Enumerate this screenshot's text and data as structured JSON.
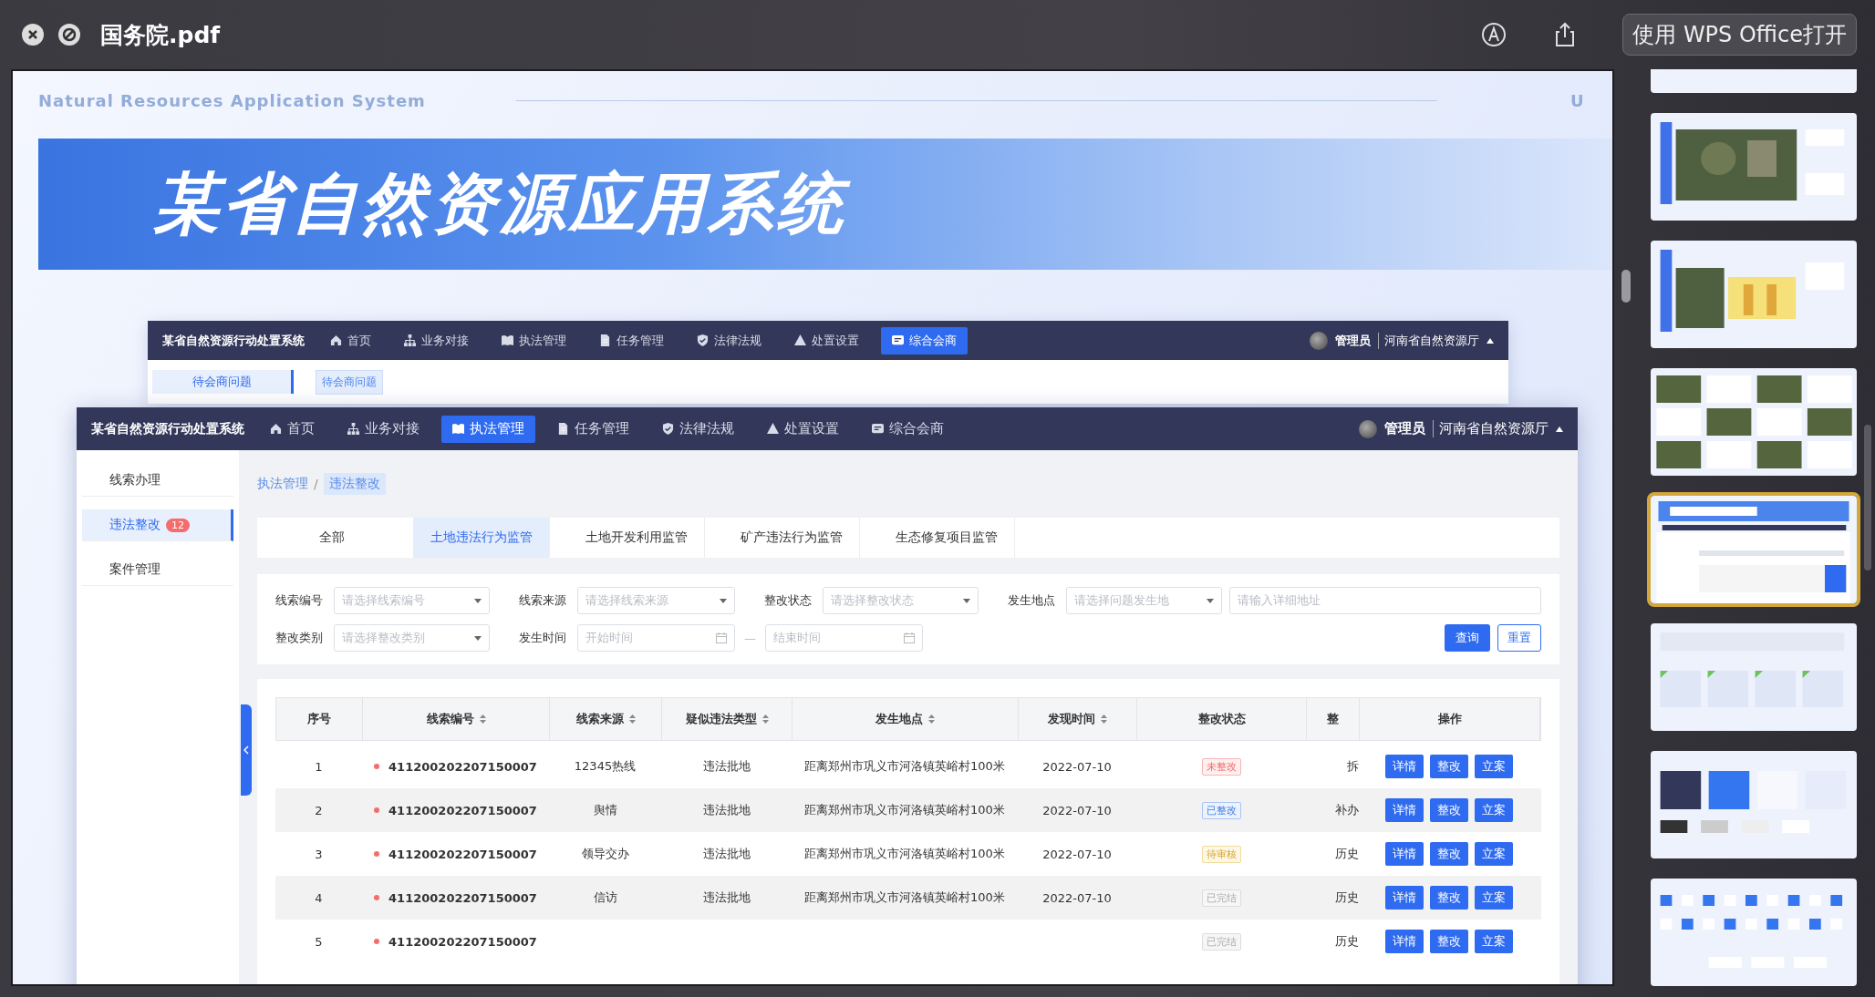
{
  "window": {
    "title": "国务院.pdf",
    "open_button": "使用 WPS Office打开"
  },
  "slide": {
    "subtitle": "Natural Resources Application System",
    "corner_text": "U",
    "title": "某省自然资源应用系统",
    "back_screen": {
      "system_title": "某省自然资源行动处置系统",
      "nav": [
        {
          "label": "首页",
          "selected": false
        },
        {
          "label": "业务对接",
          "selected": false
        },
        {
          "label": "执法管理",
          "selected": false
        },
        {
          "label": "任务管理",
          "selected": false
        },
        {
          "label": "法律法规",
          "selected": false
        },
        {
          "label": "处置设置",
          "selected": false
        },
        {
          "label": "综合会商",
          "selected": true
        }
      ],
      "user": "管理员",
      "org": "河南省自然资源厅",
      "sidebar_item": "待会商问题",
      "tag": "待会商问题"
    },
    "front_screen": {
      "system_title": "某省自然资源行动处置系统",
      "nav": [
        {
          "label": "首页",
          "selected": false
        },
        {
          "label": "业务对接",
          "selected": false
        },
        {
          "label": "执法管理",
          "selected": true
        },
        {
          "label": "任务管理",
          "selected": false
        },
        {
          "label": "法律法规",
          "selected": false
        },
        {
          "label": "处置设置",
          "selected": false
        },
        {
          "label": "综合会商",
          "selected": false
        }
      ],
      "user": "管理员",
      "org": "河南省自然资源厅",
      "sidebar": [
        {
          "label": "线索办理",
          "selected": false
        },
        {
          "label": "违法整改",
          "selected": true,
          "badge": "12"
        },
        {
          "label": "案件管理",
          "selected": false
        }
      ],
      "breadcrumb": [
        "执法管理",
        "违法整改"
      ],
      "breadcrumb_separator": "/",
      "tabs": [
        {
          "label": "全部",
          "selected": false
        },
        {
          "label": "土地违法行为监管",
          "selected": true
        },
        {
          "label": "土地开发利用监管",
          "selected": false
        },
        {
          "label": "矿产违法行为监管",
          "selected": false
        },
        {
          "label": "生态修复项目监管",
          "selected": false
        }
      ],
      "filters": [
        {
          "kind": "select",
          "label": "线索编号",
          "placeholder": "请选择线索编号"
        },
        {
          "kind": "select",
          "label": "线索来源",
          "placeholder": "请选择线索来源"
        },
        {
          "kind": "select",
          "label": "整改状态",
          "placeholder": "请选择整改状态"
        },
        {
          "kind": "location",
          "label": "发生地点",
          "placeholder": "请选择问题发生地",
          "detail_placeholder": "请输入详细地址"
        },
        {
          "kind": "select",
          "label": "整改类别",
          "placeholder": "请选择整改类别"
        },
        {
          "kind": "daterange",
          "label": "发生时间",
          "placeholder": "开始时间",
          "end_placeholder": "结束时间",
          "separator": "—"
        }
      ],
      "search_button": "查询",
      "reset_button": "重置",
      "table": {
        "columns": [
          {
            "label": "序号",
            "sortable": false
          },
          {
            "label": "线索编号",
            "sortable": true
          },
          {
            "label": "线索来源",
            "sortable": true
          },
          {
            "label": "疑似违法类型",
            "sortable": true
          },
          {
            "label": "发生地点",
            "sortable": true
          },
          {
            "label": "发现时间",
            "sortable": true
          },
          {
            "label": "整改状态",
            "sortable": false
          },
          {
            "label": "整",
            "sortable": false
          },
          {
            "label": "操作",
            "sortable": false
          }
        ],
        "rows": [
          {
            "seq": "1",
            "clue_id": "411200202207150007",
            "source": "12345热线",
            "type": "违法批地",
            "location": "距离郑州市巩义市河洛镇英峪村100米",
            "date": "2022-07-10",
            "status": {
              "label": "未整改",
              "kind": "pending"
            },
            "column_8": "拆",
            "actions": [
              "详情",
              "整改",
              "立案"
            ]
          },
          {
            "seq": "2",
            "clue_id": "411200202207150007",
            "source": "舆情",
            "type": "违法批地",
            "location": "距离郑州市巩义市河洛镇英峪村100米",
            "date": "2022-07-10",
            "status": {
              "label": "已整改",
              "kind": "done"
            },
            "column_8": "补办",
            "actions": [
              "详情",
              "整改",
              "立案"
            ]
          },
          {
            "seq": "3",
            "clue_id": "411200202207150007",
            "source": "领导交办",
            "type": "违法批地",
            "location": "距离郑州市巩义市河洛镇英峪村100米",
            "date": "2022-07-10",
            "status": {
              "label": "待审核",
              "kind": "review"
            },
            "column_8": "历史",
            "actions": [
              "详情",
              "整改",
              "立案"
            ]
          },
          {
            "seq": "4",
            "clue_id": "411200202207150007",
            "source": "信访",
            "type": "违法批地",
            "location": "距离郑州市巩义市河洛镇英峪村100米",
            "date": "2022-07-10",
            "status": {
              "label": "已完结",
              "kind": "closed"
            },
            "column_8": "历史",
            "actions": [
              "详情",
              "整改",
              "立案"
            ]
          },
          {
            "seq": "5",
            "clue_id": "411200202207150007",
            "status": {
              "label": "已完结",
              "kind": "closed"
            },
            "column_8": "历史",
            "actions": [
              "详情",
              "整改",
              "立案"
            ]
          }
        ]
      }
    }
  },
  "thumbnails": [
    {
      "kind": "blank",
      "selected": false
    },
    {
      "kind": "map",
      "selected": false
    },
    {
      "kind": "map-table",
      "selected": false
    },
    {
      "kind": "grid",
      "selected": false
    },
    {
      "kind": "title",
      "selected": true
    },
    {
      "kind": "cards",
      "selected": false
    },
    {
      "kind": "colors",
      "selected": false
    },
    {
      "kind": "icons",
      "selected": false
    }
  ]
}
